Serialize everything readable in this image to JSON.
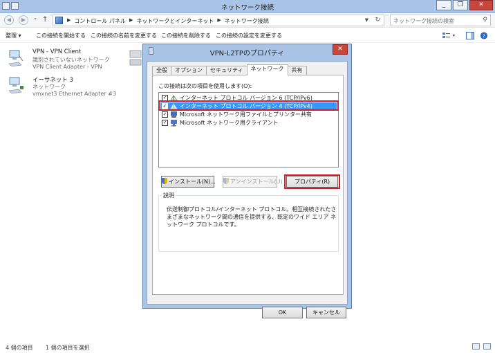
{
  "window": {
    "title": "ネットワーク接続",
    "minimize": "_",
    "maximize": "❐",
    "close": "✕"
  },
  "address": {
    "crumbs": [
      "コントロール パネル",
      "ネットワークとインターネット",
      "ネットワーク接続"
    ],
    "search_placeholder": "ネットワーク接続の検索"
  },
  "toolbar": {
    "organize": "整理 ▾",
    "start": "この接続を開始する",
    "rename": "この接続の名前を変更する",
    "delete": "この接続を削除する",
    "settings": "この接続の設定を変更する"
  },
  "connections": [
    {
      "name": "VPN - VPN Client",
      "status": "識別されていないネットワーク",
      "adapter": "VPN Client Adapter - VPN"
    },
    {
      "name": "イーサネット 3",
      "status": "ネットワーク",
      "adapter": "vmxnet3 Ethernet Adapter #3"
    }
  ],
  "status": {
    "count": "4 個の項目",
    "selected": "1 個の項目を選択"
  },
  "dialog": {
    "title": "VPN-L2TPのプロパティ",
    "close": "✕",
    "tabs": [
      "全般",
      "オプション",
      "セキュリティ",
      "ネットワーク",
      "共有"
    ],
    "active_tab": "ネットワーク",
    "uses_label": "この接続は次の項目を使用します(O):",
    "items": [
      {
        "label": "インターネット プロトコル バージョン 6 (TCP/IPv6)",
        "checked": "✓"
      },
      {
        "label": "インターネット プロトコル バージョン 4 (TCP/IPv4)",
        "checked": "✓"
      },
      {
        "label": "Microsoft ネットワーク用ファイルとプリンター共有",
        "checked": "✓"
      },
      {
        "label": "Microsoft ネットワーク用クライアント",
        "checked": "✓"
      }
    ],
    "install": "インストール(N)...",
    "uninstall": "アンインストール(U)",
    "properties": "プロパティ(R)",
    "description_label": "説明",
    "description": "伝送制御プロトコル/インターネット プロトコル。相互接続されたさまざまなネットワーク間の通信を提供する、既定のワイド エリア ネットワーク プロトコルです。",
    "ok": "OK",
    "cancel": "キャンセル"
  },
  "colors": {
    "titlebar": "#a9c4e6",
    "selection": "#3399ff",
    "highlight_box": "#d21e28",
    "close_button": "#c9463d"
  }
}
